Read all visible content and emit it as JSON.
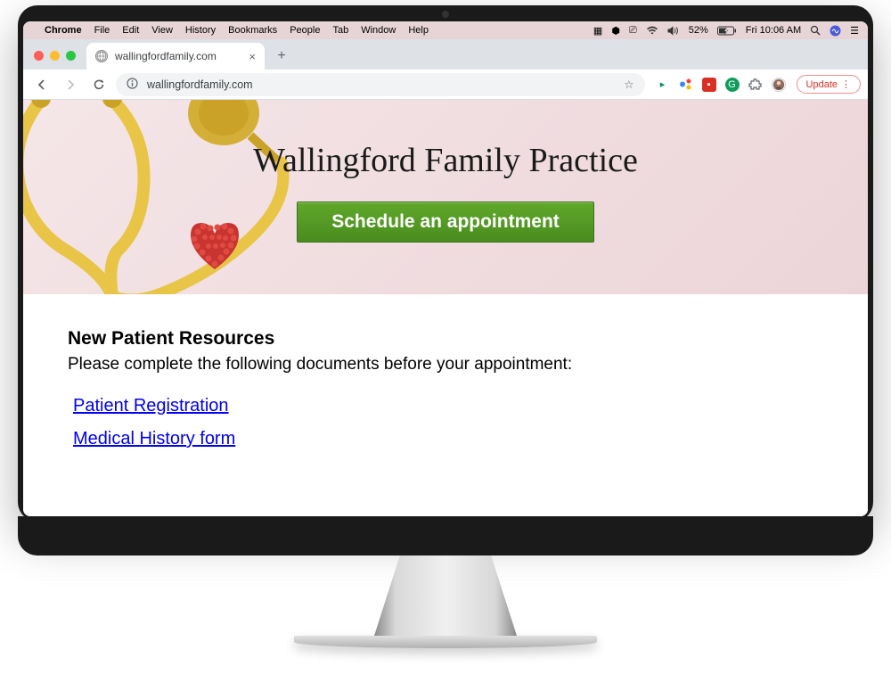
{
  "mac_menubar": {
    "app_name": "Chrome",
    "menus": [
      "File",
      "Edit",
      "View",
      "History",
      "Bookmarks",
      "People",
      "Tab",
      "Window",
      "Help"
    ],
    "battery": "52%",
    "clock": "Fri 10:06 AM"
  },
  "browser": {
    "tab_title": "wallingfordfamily.com",
    "url": "wallingfordfamily.com",
    "update_label": "Update"
  },
  "page": {
    "hero_title": "Wallingford Family Practice",
    "schedule_button": "Schedule an appointment",
    "resources_heading": "New Patient Resources",
    "resources_intro": "Please complete the following documents before your appointment:",
    "links": {
      "registration": "Patient Registration",
      "history": "Medical History form"
    }
  }
}
